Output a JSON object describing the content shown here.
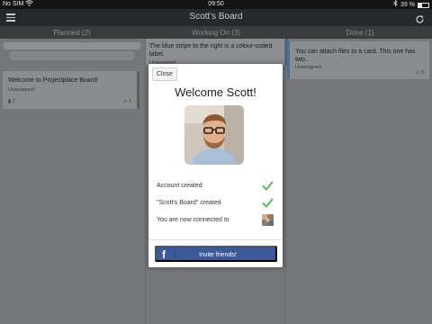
{
  "status_bar": {
    "carrier": "No SIM",
    "time": "09:50",
    "battery_text": "39 %",
    "battery_level": 0.39
  },
  "header": {
    "title": "Scott's Board"
  },
  "columns": [
    {
      "label": "Planned (2)"
    },
    {
      "label": "Working On (3)"
    },
    {
      "label": "Done (1)"
    }
  ],
  "cards": {
    "planned_1": {
      "title": "Welcome to Projectplace Board!",
      "assignee": "Unassigned",
      "comments": "2",
      "attachments": "1"
    },
    "working_1": {
      "title": "The blue stripe to the right is a colour-coded label.",
      "assignee": "Unassigned"
    },
    "done_1": {
      "title": "You can attach files to a card. This one has two.",
      "assignee": "Unassigned",
      "attachments": "5"
    }
  },
  "modal": {
    "close_label": "Close",
    "title": "Welcome Scott!",
    "rows": [
      {
        "label": "Account created",
        "icon": "check-icon"
      },
      {
        "label": "\"Scott's Board\" created",
        "icon": "check-icon"
      },
      {
        "label": "You are now connected to",
        "icon": "connection-thumbnail"
      }
    ],
    "invite_label": "Invite friends!",
    "invite_icon": "facebook-icon",
    "accent_check": "#5cb85c",
    "facebook_blue": "#3b5998"
  }
}
